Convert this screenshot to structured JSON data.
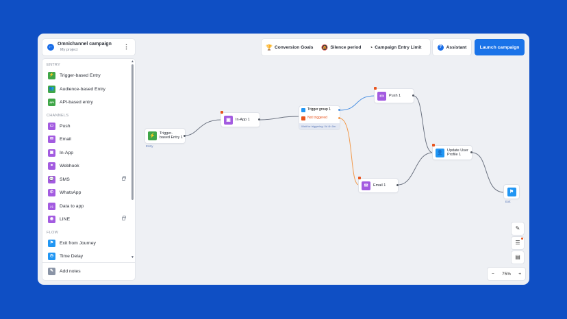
{
  "project": {
    "title": "Omnichannel campaign",
    "subtitle": "My project"
  },
  "sidebar": {
    "sections": [
      {
        "title": "ENTRY",
        "items": [
          {
            "label": "Trigger-based Entry",
            "icon": "lightning-icon",
            "glyph": "⚡",
            "color": "#3fa648",
            "locked": false
          },
          {
            "label": "Audience-based Entry",
            "icon": "audience-icon",
            "glyph": "👥",
            "color": "#3fa648",
            "locked": false
          },
          {
            "label": "API-based entry",
            "icon": "api-icon",
            "glyph": "API",
            "color": "#3fa648",
            "locked": false
          }
        ]
      },
      {
        "title": "CHANNELS",
        "items": [
          {
            "label": "Push",
            "icon": "push-icon",
            "glyph": "▭",
            "color": "#a35be0",
            "locked": false
          },
          {
            "label": "Email",
            "icon": "email-icon",
            "glyph": "✉",
            "color": "#a35be0",
            "locked": false
          },
          {
            "label": "In-App",
            "icon": "in-app-icon",
            "glyph": "▣",
            "color": "#a35be0",
            "locked": false
          },
          {
            "label": "Webhook",
            "icon": "webhook-icon",
            "glyph": "⚭",
            "color": "#a35be0",
            "locked": false
          },
          {
            "label": "SMS",
            "icon": "sms-icon",
            "glyph": "💬",
            "color": "#a35be0",
            "locked": true
          },
          {
            "label": "WhatsApp",
            "icon": "whatsapp-icon",
            "glyph": "✆",
            "color": "#a35be0",
            "locked": false
          },
          {
            "label": "Data to app",
            "icon": "data-to-app-icon",
            "glyph": "{·}",
            "color": "#a35be0",
            "locked": false
          },
          {
            "label": "LINE",
            "icon": "line-icon",
            "glyph": "◉",
            "color": "#a35be0",
            "locked": true
          }
        ]
      },
      {
        "title": "FLOW",
        "items": [
          {
            "label": "Exit from Journey",
            "icon": "flag-icon",
            "glyph": "⚑",
            "color": "#2196f3",
            "locked": false
          },
          {
            "label": "Time Delay",
            "icon": "clock-icon",
            "glyph": "◷",
            "color": "#2196f3",
            "locked": false
          }
        ]
      }
    ],
    "footer": {
      "label": "Add notes"
    }
  },
  "toolbar": {
    "conversion_goals": "Conversion Goals",
    "silence_period": "Silence period",
    "entry_limit": "Campaign Entry Limit",
    "assistant": "Assistant",
    "launch": "Launch campaign"
  },
  "canvas": {
    "nodes": {
      "trigger_entry": {
        "label_line1": "Trigger-",
        "label_line2": "based Entry 1",
        "caption": "Entry"
      },
      "in_app": {
        "label": "In-App 1"
      },
      "trigger_group": {
        "label": "Trigger group 1",
        "not_triggered": "Not triggered",
        "caption": "Wait for triggering: 0d 4h 0m"
      },
      "push": {
        "label": "Push 1"
      },
      "email": {
        "label": "Email 1"
      },
      "update_profile": {
        "label_line1": "Update User",
        "label_line2": "Profile 1"
      },
      "exit": {
        "caption": "Exit"
      }
    },
    "zoom": {
      "minus": "−",
      "value": "75%",
      "plus": "+"
    }
  },
  "colors": {
    "accent": "#1a73e8",
    "channel": "#a35be0",
    "entry": "#3fa648",
    "flow": "#2196f3",
    "warning": "#e8541d"
  }
}
